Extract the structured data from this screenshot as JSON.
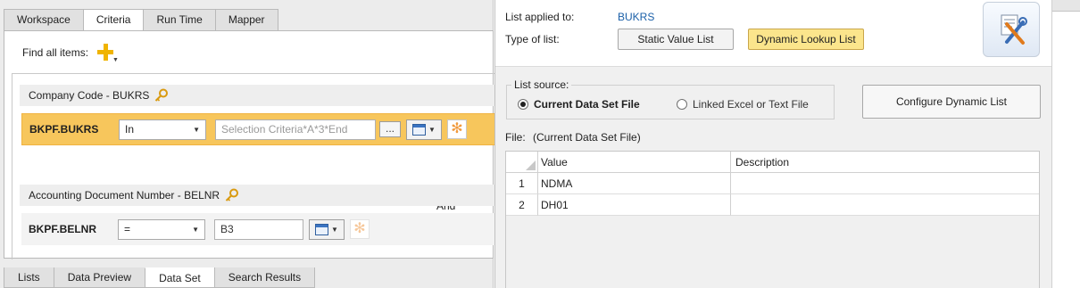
{
  "top_tabs": [
    {
      "label": "Workspace",
      "active": false
    },
    {
      "label": "Criteria",
      "active": true
    },
    {
      "label": "Run Time",
      "active": false
    },
    {
      "label": "Mapper",
      "active": false
    }
  ],
  "criteria": {
    "find_label": "Find all items:",
    "groups": [
      {
        "title": "Company Code - BUKRS",
        "field": "BKPF.BUKRS",
        "operator": "In",
        "value": "",
        "placeholder": "Selection Criteria*A*3*End",
        "ellipsis": "...",
        "selected": true
      },
      {
        "title": "Accounting Document Number - BELNR",
        "field": "BKPF.BELNR",
        "operator": "=",
        "value": "B3",
        "placeholder": "",
        "selected": false
      }
    ],
    "connector": "And"
  },
  "bottom_tabs": [
    {
      "label": "Lists",
      "active": false
    },
    {
      "label": "Data Preview",
      "active": false
    },
    {
      "label": "Data Set",
      "active": true
    },
    {
      "label": "Search Results",
      "active": false
    }
  ],
  "list_panel": {
    "applied_label": "List applied to:",
    "applied_value": "BUKRS",
    "type_label": "Type of list:",
    "static_button": "Static Value List",
    "dynamic_button": "Dynamic Lookup List",
    "source_legend": "List source:",
    "radio_current": "Current Data Set File",
    "radio_linked": "Linked Excel or Text File",
    "configure_button": "Configure Dynamic List",
    "file_label": "File:",
    "file_value": "(Current Data Set File)",
    "grid": {
      "columns": [
        "Value",
        "Description"
      ],
      "rows": [
        {
          "num": "1",
          "value": "NDMA",
          "description": ""
        },
        {
          "num": "2",
          "value": "DH01",
          "description": ""
        }
      ]
    }
  },
  "colors": {
    "selected_row": "#f7c65c",
    "active_toggle": "#fbe58c",
    "link_blue": "#1a5fa8",
    "add_icon": "#f0b400"
  }
}
